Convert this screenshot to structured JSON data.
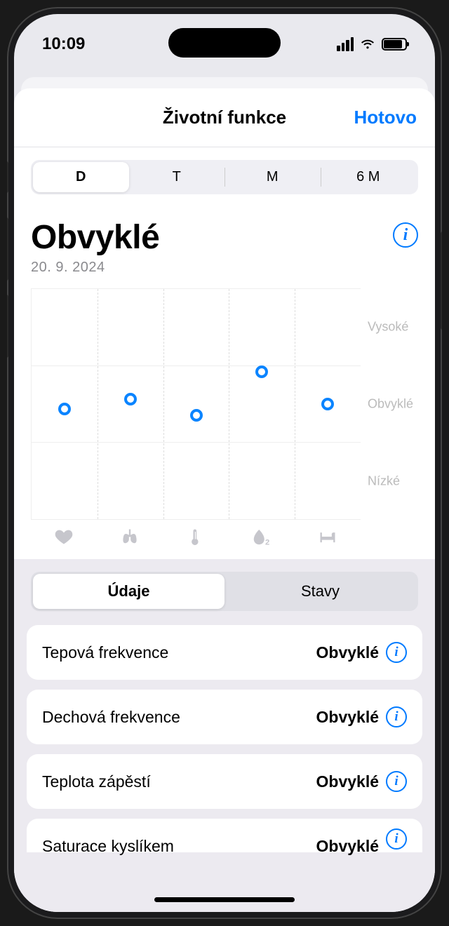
{
  "status": {
    "time": "10:09"
  },
  "header": {
    "title": "Životní funkce",
    "done": "Hotovo"
  },
  "range_tabs": {
    "items": [
      "D",
      "T",
      "M",
      "6 M"
    ],
    "active_index": 0
  },
  "summary": {
    "title": "Obvyklé",
    "date": "20. 9. 2024"
  },
  "chart_data": {
    "type": "scatter",
    "title": "Obvyklé",
    "xlabel": "",
    "ylabel": "",
    "categories": [
      "heart",
      "lungs",
      "thermometer",
      "oxygen",
      "bed"
    ],
    "y_levels": [
      "Nízké",
      "Obvyklé",
      "Vysoké"
    ],
    "ylim": [
      0,
      100
    ],
    "series": [
      {
        "name": "vitals",
        "values": [
          48,
          52,
          45,
          64,
          50
        ]
      }
    ],
    "y_tick_labels": {
      "Vysoké": 83.3,
      "Obvyklé": 50,
      "Nízké": 16.7
    }
  },
  "view_tabs": {
    "items": [
      "Údaje",
      "Stavy"
    ],
    "active_index": 0
  },
  "metrics": [
    {
      "label": "Tepová frekvence",
      "value": "Obvyklé"
    },
    {
      "label": "Dechová frekvence",
      "value": "Obvyklé"
    },
    {
      "label": "Teplota zápěstí",
      "value": "Obvyklé"
    },
    {
      "label": "Saturace kyslíkem",
      "value": "Obvyklé"
    }
  ]
}
